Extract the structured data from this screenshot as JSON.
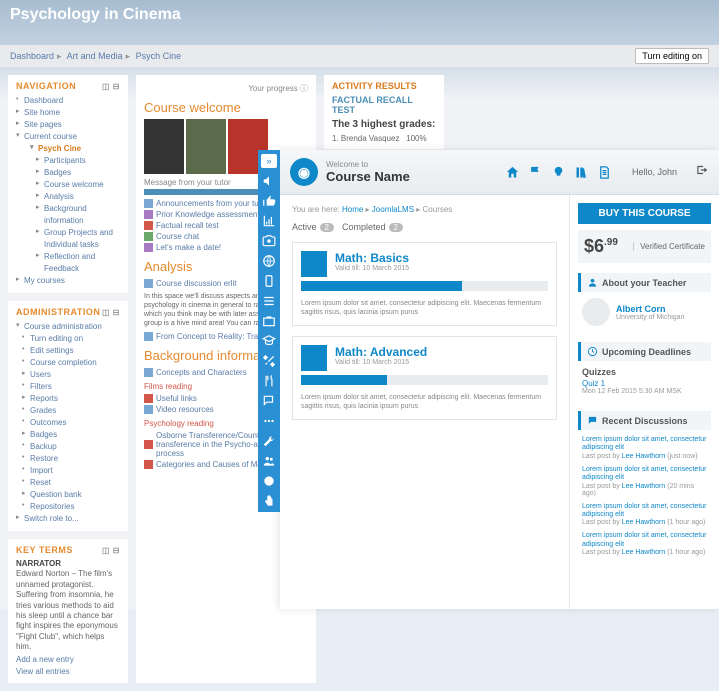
{
  "moodle": {
    "title": "Psychology in Cinema",
    "breadcrumb": [
      "Dashboard",
      "Art and Media",
      "Psych Cine"
    ],
    "edit_btn": "Turn editing on",
    "nav": {
      "heading": "NAVIGATION",
      "items": [
        "Dashboard",
        "Site home",
        "Site pages",
        "Current course"
      ],
      "course": "Psych Cine",
      "course_items": [
        "Participants",
        "Badges",
        "Course welcome",
        "Analysis",
        "Background information",
        "Group Projects and Individual tasks",
        "Reflection and Feedback"
      ],
      "my_courses": "My courses"
    },
    "admin": {
      "heading": "ADMINISTRATION",
      "root": "Course administration",
      "items": [
        "Turn editing on",
        "Edit settings",
        "Course completion",
        "Users",
        "Filters",
        "Reports",
        "Grades",
        "Outcomes",
        "Badges",
        "Backup",
        "Restore",
        "Import",
        "Reset",
        "Question bank",
        "Repositories"
      ],
      "switch": "Switch role to..."
    },
    "keyterms": {
      "heading": "KEY TERMS",
      "term": "NARRATOR",
      "desc": "Edward Norton – The film's unnamed protagonist. Suffering from insomnia, he tries various methods to aid his sleep until a chance bar fight inspires the eponymous \"Fight Club\", which helps him.",
      "add": "Add a new entry",
      "view": "View all entries"
    },
    "progress": "Your progress",
    "welcome": {
      "h": "Course welcome",
      "msg": "Message from your tutor",
      "links": [
        "Announcements from your tutor",
        "Prior Knowledge assessment",
        "Factual recall test",
        "Course chat",
        "Let's make a date!"
      ]
    },
    "analysis": {
      "h": "Analysis",
      "link": "Course discussion erlit",
      "text": "In this space we'll discuss aspects and of psychology in cinema in general to raise issues which you think may be with later assignments and group is a hive mind area! You can rate view ratings.",
      "link2": "From Concept to Reality: Trauma"
    },
    "bg": {
      "h": "Background information",
      "l1": "Concepts and Characters",
      "sub1": "Films reading",
      "l2": "Useful links",
      "l3": "Video resources",
      "sub2": "Psychology reading",
      "l4": "Osborne Transference/Counter transference in the Psycho-analysis process",
      "l5": "Categories and Causes of Mental"
    },
    "ar": {
      "heading": "ACTIVITY RESULTS",
      "test": "FACTUAL RECALL TEST",
      "sub": "The 3 highest grades:",
      "row": "1. Brenda Vasquez",
      "pct": "100%"
    }
  },
  "joomla": {
    "welcome": "Welcome to",
    "title": "Course Name",
    "hello": "Hello, John",
    "bc_pre": "You are here:",
    "bc": [
      "Home",
      "JoomlaLMS",
      "Courses"
    ],
    "tabs": {
      "active": "Active",
      "active_n": "2",
      "completed": "Completed",
      "completed_n": "2"
    },
    "courses": [
      {
        "title": "Math: Basics",
        "date": "Valid till: 10 March 2015",
        "pct": 65,
        "desc": "Lorem ipsum dolor sit amet, consectetur adipiscing elit. Maecenas fermentum sagittis risus, quis lacinia ipsum purus"
      },
      {
        "title": "Math: Advanced",
        "date": "Valid till: 10 March 2015",
        "pct": 35,
        "desc": "Lorem ipsum dolor sit amet, consectetur adipiscing elit. Maecenas fermentum sagittis risus, quis lacinia ipsum purus"
      }
    ],
    "buy": "BUY THIS COURSE",
    "price_cur": "$",
    "price_whole": "6",
    "price_dec": ".99",
    "cert": "Verified Certificate",
    "teacher_h": "About your Teacher",
    "teacher_n": "Albert Corn",
    "teacher_u": "University of Michigan",
    "deadlines_h": "Upcoming Deadlines",
    "quizzes": "Quizzes",
    "quiz": "Quiz 1",
    "quiz_d": "Mon 12 Feb 2015 5:30 AM MSK",
    "disc_h": "Recent Discussions",
    "disc": [
      {
        "t": "Lorem ipsum dolor sit amet, consectetur adipiscing elit",
        "by": "Lee Hawthorn",
        "when": "(just now)"
      },
      {
        "t": "Lorem ipsum dolor sit amet, consectetur adipiscing elit",
        "by": "Lee Hawthorn",
        "when": "(20 mins ago)"
      },
      {
        "t": "Lorem ipsum dolor sit amet, consectetur adipiscing elit",
        "by": "Lee Hawthorn",
        "when": "(1 hour ago)"
      },
      {
        "t": "Lorem ipsum dolor sit amet, consectetur adipiscing elit",
        "by": "Lee Hawthorn",
        "when": "(1 hour ago)"
      }
    ],
    "meta": "Last post by"
  }
}
